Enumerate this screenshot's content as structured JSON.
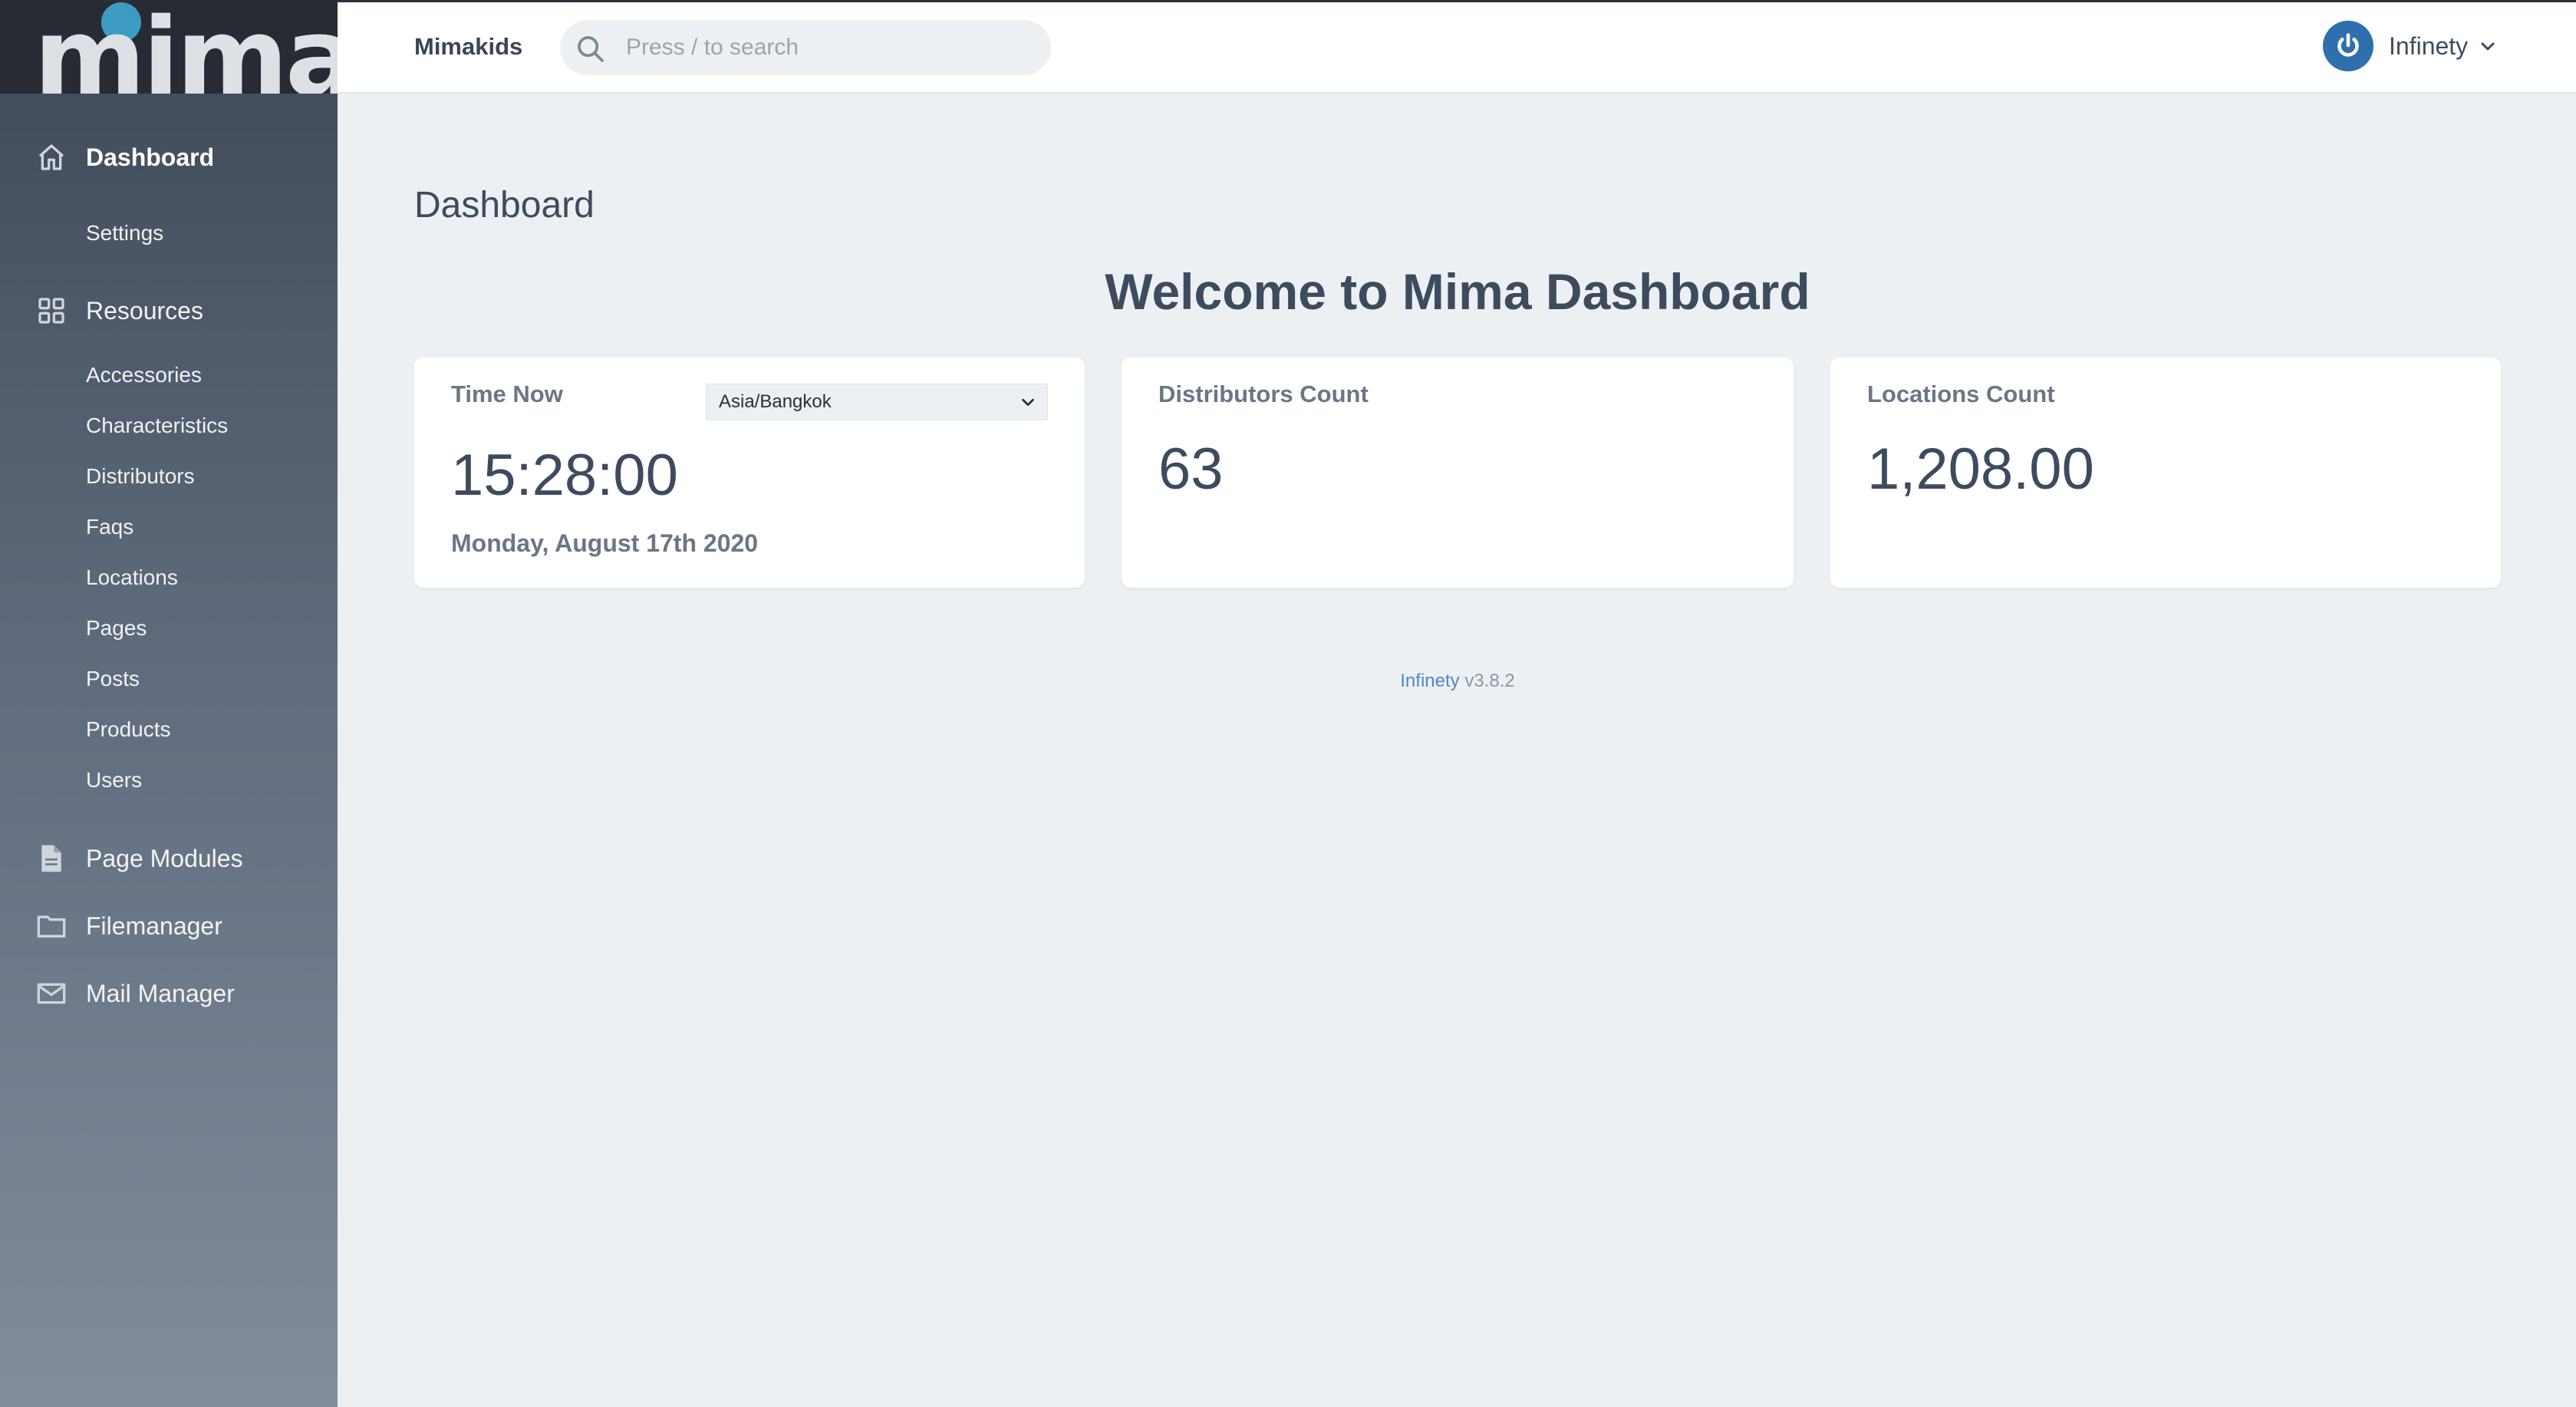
{
  "logo": {
    "text": "mima",
    "dot_color": "#3e9bc3"
  },
  "sidebar": {
    "sections": [
      {
        "label": "Dashboard",
        "icon": "home-icon",
        "active": true
      },
      {
        "label": "Resources",
        "icon": "grid-icon"
      },
      {
        "label": "Page Modules",
        "icon": "document-icon"
      },
      {
        "label": "Filemanager",
        "icon": "folder-icon"
      },
      {
        "label": "Mail Manager",
        "icon": "mail-icon"
      }
    ],
    "dashboard_items": [
      "Settings"
    ],
    "resource_items": [
      "Accessories",
      "Characteristics",
      "Distributors",
      "Faqs",
      "Locations",
      "Pages",
      "Posts",
      "Products",
      "Users"
    ]
  },
  "header": {
    "app_name": "Mimakids",
    "search_placeholder": "Press / to search",
    "user_name": "Infinety",
    "avatar_icon": "power-icon",
    "avatar_color": "#2f6fad"
  },
  "main": {
    "page_title": "Dashboard",
    "welcome": "Welcome to Mima Dashboard",
    "cards": {
      "clock": {
        "label": "Time Now",
        "timezone": "Asia/Bangkok",
        "time": "15:28:00",
        "date": "Monday, August 17th 2020"
      },
      "distributors": {
        "label": "Distributors Count",
        "value": "63"
      },
      "locations": {
        "label": "Locations Count",
        "value": "1,208.00"
      }
    }
  },
  "footer": {
    "link": "Infinety",
    "version": "v3.8.2",
    "link_color": "#4e89c7"
  }
}
